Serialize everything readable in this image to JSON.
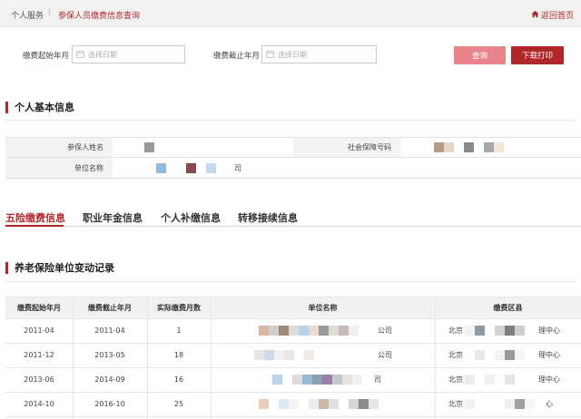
{
  "breadcrumb": {
    "home": "个人服务",
    "separator": "|",
    "current": "参保人员缴费信息查询",
    "back": "返回首页"
  },
  "filters": {
    "start_label": "缴费起始年月",
    "start_placeholder": "选择日期",
    "end_label": "缴费截止年月",
    "end_placeholder": "选择日期",
    "query_button": "查询",
    "print_button": "下载打印"
  },
  "basic_info": {
    "title": "个人基本信息",
    "name_label": "参保人姓名",
    "ssn_label": "社会保障号码",
    "employer_label": "单位名称",
    "employer_suffix": "司"
  },
  "tabs": [
    "五险缴费信息",
    "职业年金信息",
    "个人补缴信息",
    "转移接续信息"
  ],
  "active_tab": 0,
  "records": {
    "title": "养老保险单位变动记录",
    "columns": [
      "缴费起始年月",
      "缴费截止年月",
      "实际缴费月数",
      "单位名称",
      "缴费区县"
    ],
    "rows": [
      {
        "start": "2011-04",
        "end": "2011-04",
        "months": "1",
        "company": "公司",
        "district_prefix": "北京",
        "district_suffix": "理中心"
      },
      {
        "start": "2011-12",
        "end": "2013-05",
        "months": "18",
        "company": "公司",
        "district_prefix": "北京",
        "district_suffix": "理中心"
      },
      {
        "start": "2013-06",
        "end": "2014-09",
        "months": "16",
        "company": "司",
        "district_prefix": "北京",
        "district_suffix": "理中心"
      },
      {
        "start": "2014-10",
        "end": "2016-10",
        "months": "25",
        "company": "",
        "district_prefix": "北京",
        "district_suffix": "心"
      }
    ]
  },
  "colors": {
    "accent": "#b1262b",
    "query_button": "#e9858a",
    "header_bg": "#f2f2f2"
  },
  "icons": {
    "home": "home-icon",
    "calendar": "calendar-icon"
  }
}
